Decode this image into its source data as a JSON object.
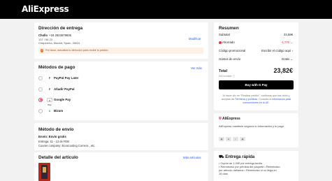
{
  "header": {
    "logo": "AliExpress"
  },
  "address": {
    "title": "Dirección de entrega",
    "name": "Chollo",
    "phone": "+34 2923679835",
    "line1": "137 / 56 23",
    "line2": "Chapinería, Madrid, Spain, 28001",
    "edit_label": "Modificar",
    "notice": "Por favor, actualiza tu dirección para recibir tu pedido"
  },
  "payment": {
    "title": "Métodos de pago",
    "see_more": "Ver más",
    "methods": [
      {
        "label": "PayPal Pay Later",
        "icon": "paypal-icon",
        "selected": false
      },
      {
        "label": "Añadir PayPal",
        "icon": "paypal-icon",
        "selected": false
      },
      {
        "label": "Google Pay",
        "icon": "google-pay-icon",
        "selected": true
      },
      {
        "label": "Bizum",
        "icon": "bizum-icon",
        "selected": false
      }
    ]
  },
  "shipping": {
    "title": "Método de envío",
    "name": "Envío: Envío gratis",
    "delivery": "Entrega: 11 - 13 de FEB",
    "courier": "Courier company:  Ecoscooting  Correos , etc."
  },
  "items": {
    "title": "Detalle del artículo",
    "more_label": "Más artículos"
  },
  "summary": {
    "title": "Resumen",
    "rows": [
      {
        "label": "Subtotal",
        "value": "23,59€"
      },
      {
        "label": "Ahorrado",
        "value": "-1,77€"
      },
      {
        "label": "Código promocional",
        "value": "Escribir el código aquí"
      },
      {
        "label": "Gastos de envío",
        "value": "Gratis"
      }
    ],
    "total_label": "Total",
    "total_value": "23,82€",
    "total_note": "IVA incluido",
    "buy_label": "Buy with  G Pay",
    "legal_1": "Al hacer clic en \"Realizar pedido\", confirmas que has leído y aceptas las",
    "legal_link_1": "Términos y políticas",
    "legal_2": ". Consulta la",
    "legal_link_2": "información para consumidores en la UE",
    "legal_3": "."
  },
  "trust": {
    "title": "AliExpress",
    "text": "AliExpress mantiene seguros tu información y tu pago"
  },
  "fast": {
    "title": "Entrega rápida",
    "line1": "• Cupón de 1,00€ por entrega tardía",
    "line2": "• Reembolso por pérdida del paquete  • Reembolso",
    "line3": "por artículo dañados  • Reembolso si no llega en",
    "line4": "15 días"
  },
  "colors": {
    "accent": "#e8344e",
    "link": "#2e5bd6",
    "topbar": "#000000"
  }
}
